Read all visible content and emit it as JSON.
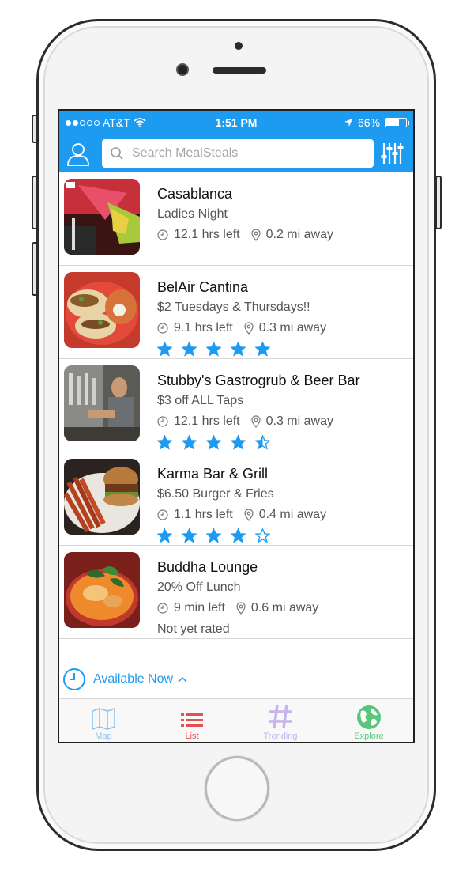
{
  "status_bar": {
    "carrier": "AT&T",
    "time": "1:51 PM",
    "battery": "66%",
    "battery_level": 0.66
  },
  "search": {
    "placeholder": "Search MealSteals"
  },
  "header_icons": {
    "profile": "user-icon",
    "filter": "sliders-icon"
  },
  "restaurants": [
    {
      "name": "Casablanca",
      "deal": "Ladies Night",
      "time_left": "12.1 hrs left",
      "distance": "0.2 mi away",
      "rating": null,
      "rating_text": ""
    },
    {
      "name": "BelAir Cantina",
      "deal": "$2 Tuesdays & Thursdays!!",
      "time_left": "9.1 hrs left",
      "distance": "0.3 mi away",
      "rating": 5
    },
    {
      "name": "Stubby's Gastrogrub & Beer Bar",
      "deal": "$3 off ALL Taps",
      "time_left": "12.1 hrs left",
      "distance": "0.3 mi away",
      "rating": 4.5
    },
    {
      "name": "Karma Bar & Grill",
      "deal": "$6.50 Burger & Fries",
      "time_left": "1.1 hrs left",
      "distance": "0.4 mi away",
      "rating": 4
    },
    {
      "name": "Buddha Lounge",
      "deal": "20% Off Lunch",
      "time_left": "9 min left",
      "distance": "0.6 mi away",
      "rating": null,
      "rating_text": "Not yet rated"
    }
  ],
  "availability": {
    "label": "Available Now"
  },
  "tabs": [
    {
      "label": "Map",
      "color": "#8fc3ec",
      "icon": "map-icon"
    },
    {
      "label": "List",
      "color": "#e15151",
      "icon": "list-icon"
    },
    {
      "label": "Trending",
      "color": "#c7b4ee",
      "icon": "hashtag-icon"
    },
    {
      "label": "Explore",
      "color": "#59c77a",
      "icon": "globe-icon"
    }
  ],
  "colors": {
    "accent": "#1d9bf0",
    "star": "#1d9bf0"
  }
}
